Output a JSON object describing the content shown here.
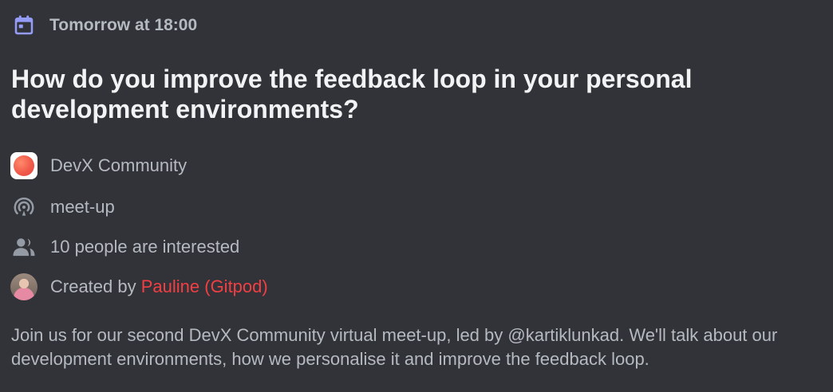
{
  "event": {
    "schedule_text": "Tomorrow at 18:00",
    "title": "How do you improve the feedback loop in your personal development environments?",
    "server_name": "DevX Community",
    "channel_name": "meet-up",
    "interested_text": "10 people are interested",
    "created_by_prefix": "Created by ",
    "creator_name": "Pauline (Gitpod)",
    "description": "Join us for our second DevX Community virtual meet-up, led by @kartiklunkad. We'll talk about our development environments, how we personalise it and improve the feedback loop."
  },
  "icons": {
    "schedule": "calendar-icon",
    "server": "server-logo",
    "channel": "stage-channel-icon",
    "interested": "people-icon",
    "creator": "avatar"
  },
  "colors": {
    "background": "#313338",
    "accent_calendar": "#949cf7",
    "creator_name": "#f23f43",
    "muted_text": "#b5bac1",
    "title_text": "#f2f3f5"
  }
}
